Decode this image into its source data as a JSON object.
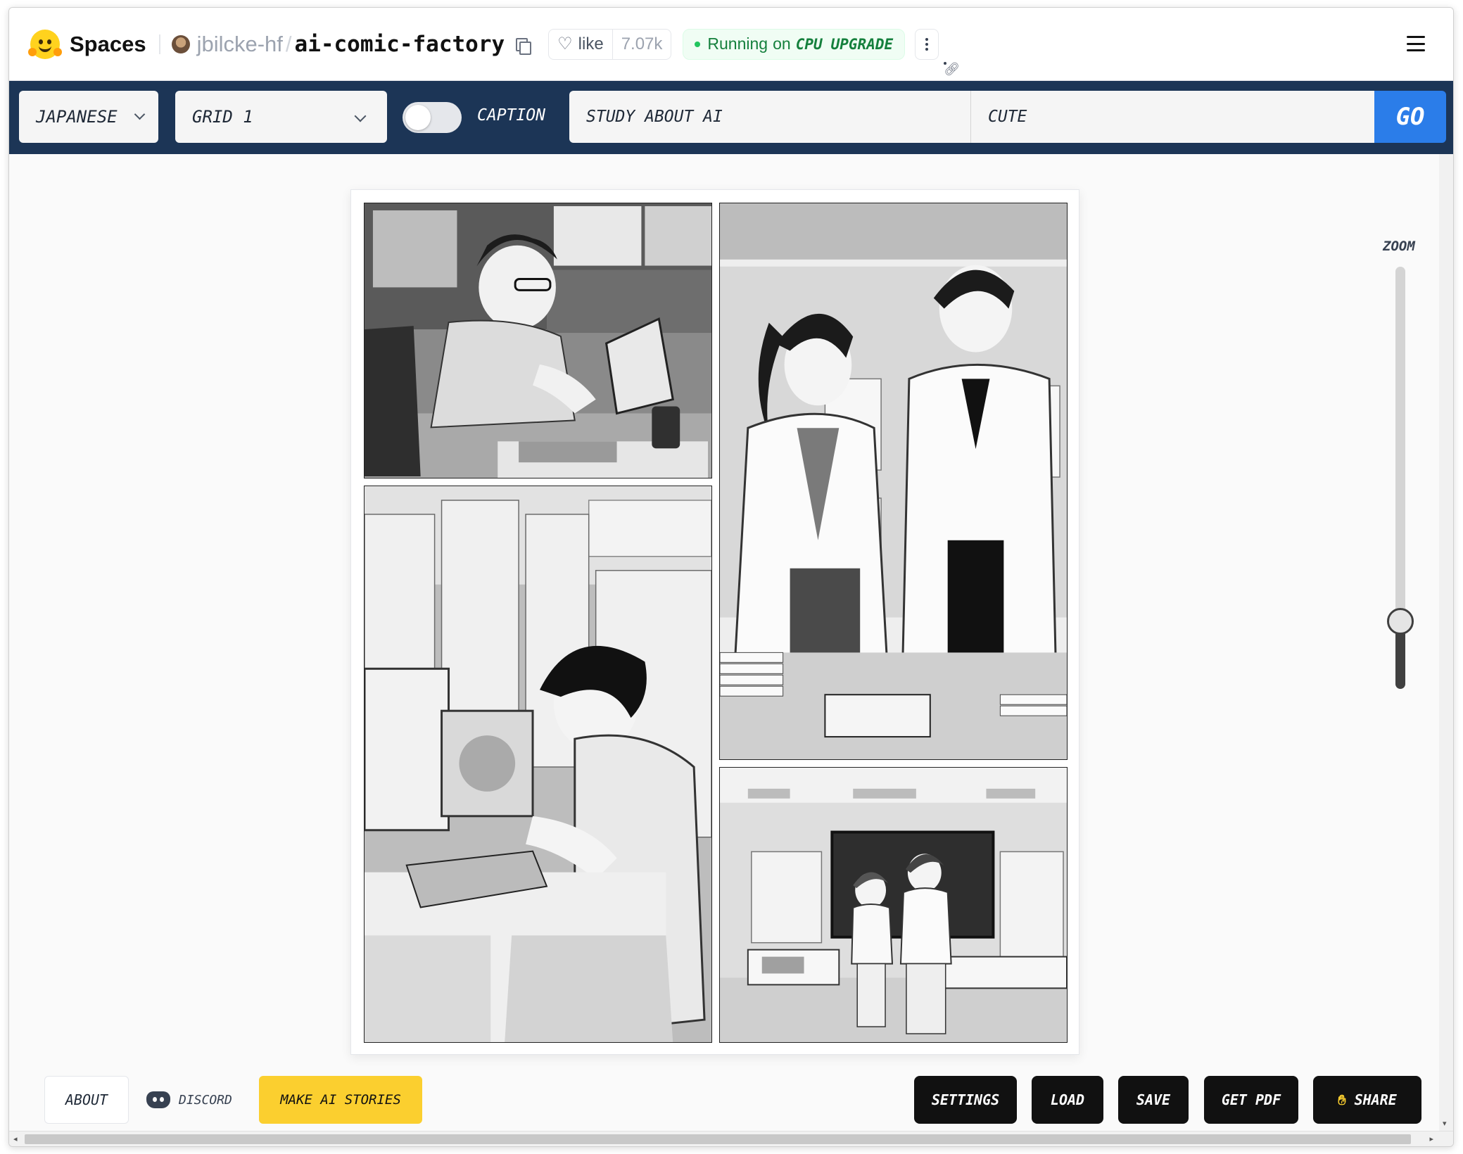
{
  "header": {
    "spaces_label": "Spaces",
    "owner": "jbilcke-hf",
    "repo": "ai-comic-factory",
    "like_label": "like",
    "like_count": "7.07k",
    "status_running": "Running",
    "status_on": "on",
    "hardware": "CPU",
    "upgrade_label": "UPGRADE"
  },
  "toolbar": {
    "preset": "JAPANESE",
    "layout": "GRID 1",
    "caption_label": "CAPTION",
    "caption_enabled": false,
    "story_prompt": "STUDY ABOUT AI",
    "style_prompt": "CUTE",
    "go_label": "GO"
  },
  "zoom": {
    "label": "ZOOM",
    "value_fraction": 0.16
  },
  "footer": {
    "about_label": "ABOUT",
    "discord_label": "DISCORD",
    "make_stories_label": "MAKE AI STORIES",
    "settings_label": "SETTINGS",
    "load_label": "LOAD",
    "save_label": "SAVE",
    "get_pdf_label": "GET PDF",
    "share_label": "SHARE"
  },
  "colors": {
    "toolbar_bg": "#1c3556",
    "go_button": "#2b7de9",
    "accent_yellow": "#fbcf2f",
    "running_green": "#15803d"
  }
}
